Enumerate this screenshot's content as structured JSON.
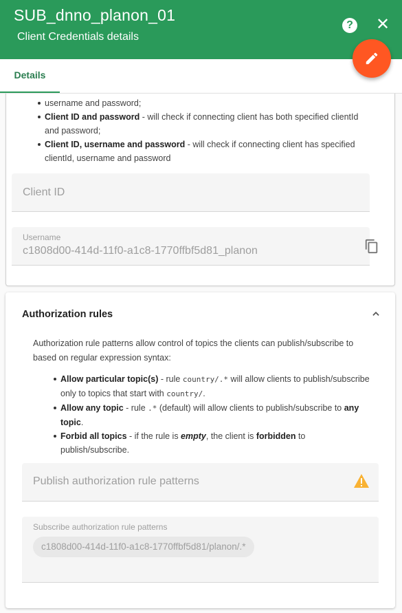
{
  "header": {
    "title": "SUB_dnno_planon_01",
    "subtitle": "Client Credentials details",
    "help_icon": "help-circle-icon",
    "close_icon": "close-icon",
    "edit_icon": "pencil-icon",
    "color": "#2a9a5a",
    "fab_color": "#ff5722"
  },
  "tabs": [
    {
      "label": "Details"
    }
  ],
  "credentials": {
    "bullet_partial_tail": "username and password;",
    "bullets": [
      {
        "bold": "Client ID and password",
        "text": " - will check if connecting client has both specified clientId and password;"
      },
      {
        "bold": "Client ID, username and password",
        "text": " - will check if connecting client has specified clientId, username and password"
      }
    ],
    "client_id_label": "Client ID",
    "username_label": "Username",
    "username_value": "c1808d00-414d-11f0-a1c8-1770ffbf5d81_planon",
    "copy_icon": "copy-icon"
  },
  "authorization": {
    "title": "Authorization rules",
    "description": "Authorization rule patterns allow control of topics the clients can publish/subscribe to based on regular expression syntax:",
    "rule_1": {
      "bold": "Allow particular topic(s)",
      "pre": " - rule ",
      "code1": "country/.*",
      "mid": " will allow clients to publish/subscribe only to topics that start with ",
      "code2": "country/",
      "post": "."
    },
    "rule_2": {
      "bold": "Allow any topic",
      "pre": " - rule ",
      "code": ".*",
      "mid": " (default) will allow clients to publish/subscribe to ",
      "bold2": "any topic",
      "post": "."
    },
    "rule_3": {
      "bold": "Forbid all topics",
      "pre": " - if the rule is ",
      "em": "empty",
      "mid": ", the client is ",
      "bold2": "forbidden",
      "post": " to publish/subscribe."
    },
    "publish_label": "Publish authorization rule patterns",
    "warning_icon": "warning-icon",
    "subscribe_label": "Subscribe authorization rule patterns",
    "subscribe_chip": "c1808d00-414d-11f0-a1c8-1770ffbf5d81/planon/.*"
  }
}
